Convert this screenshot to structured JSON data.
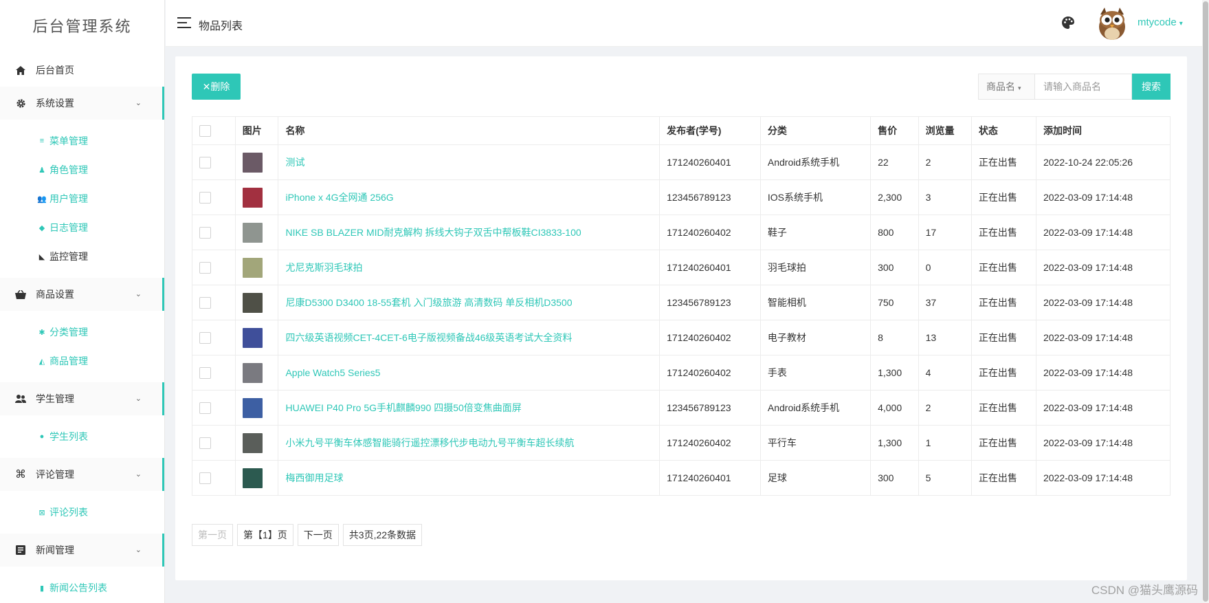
{
  "sidebar": {
    "brand": "后台管理系统",
    "home_label": "后台首页",
    "groups": [
      {
        "label": "系统设置",
        "icon": "gear-icon",
        "items": [
          {
            "label": "菜单管理",
            "icon": "list-icon"
          },
          {
            "label": "角色管理",
            "icon": "user-gear-icon"
          },
          {
            "label": "用户管理",
            "icon": "users-icon"
          },
          {
            "label": "日志管理",
            "icon": "tag-icon"
          },
          {
            "label": "监控管理",
            "icon": "cctv-icon"
          }
        ]
      },
      {
        "label": "商品设置",
        "icon": "basket-icon",
        "items": [
          {
            "label": "分类管理",
            "icon": "asterisk-icon"
          },
          {
            "label": "商品管理",
            "icon": "shirt-icon"
          }
        ]
      },
      {
        "label": "学生管理",
        "icon": "users-icon",
        "items": [
          {
            "label": "学生列表",
            "icon": "user-icon"
          }
        ]
      },
      {
        "label": "评论管理",
        "icon": "command-icon",
        "items": [
          {
            "label": "评论列表",
            "icon": "grid-icon"
          }
        ]
      },
      {
        "label": "新闻管理",
        "icon": "newspaper-icon",
        "items": [
          {
            "label": "新闻公告列表",
            "icon": "book-icon"
          }
        ]
      }
    ]
  },
  "header": {
    "title": "物品列表",
    "username": "mtycode",
    "caret": "▾"
  },
  "toolbar": {
    "delete_label": "✕删除",
    "search_field_label": "商品名",
    "search_field_caret": "▾",
    "search_placeholder": "请输入商品名",
    "search_button": "搜索"
  },
  "table": {
    "columns": [
      "图片",
      "名称",
      "发布者(学号)",
      "分类",
      "售价",
      "浏览量",
      "状态",
      "添加时间"
    ],
    "rows": [
      {
        "thumb_color": "#6b5a66",
        "name": "测试",
        "publisher": "171240260401",
        "category": "Android系统手机",
        "price": "22",
        "views": "2",
        "status": "正在出售",
        "time": "2022-10-24 22:05:26"
      },
      {
        "thumb_color": "#a23040",
        "name": "iPhone x 4G全网通 256G",
        "publisher": "123456789123",
        "category": "IOS系统手机",
        "price": "2,300",
        "views": "3",
        "status": "正在出售",
        "time": "2022-03-09 17:14:48"
      },
      {
        "thumb_color": "#8f9590",
        "name": "NIKE SB BLAZER MID耐克解构 拆线大钩子双舌中帮板鞋CI3833-100",
        "publisher": "171240260402",
        "category": "鞋子",
        "price": "800",
        "views": "17",
        "status": "正在出售",
        "time": "2022-03-09 17:14:48"
      },
      {
        "thumb_color": "#a2a67a",
        "name": "尤尼克斯羽毛球拍",
        "publisher": "171240260401",
        "category": "羽毛球拍",
        "price": "300",
        "views": "0",
        "status": "正在出售",
        "time": "2022-03-09 17:14:48"
      },
      {
        "thumb_color": "#4f5047",
        "name": "尼康D5300 D3400 18-55套机 入门级旅游 高清数码 单反相机D3500",
        "publisher": "123456789123",
        "category": "智能相机",
        "price": "750",
        "views": "37",
        "status": "正在出售",
        "time": "2022-03-09 17:14:48"
      },
      {
        "thumb_color": "#3f4f9a",
        "name": "四六级英语视频CET-4CET-6电子版视频备战46级英语考试大全资料",
        "publisher": "171240260402",
        "category": "电子教材",
        "price": "8",
        "views": "13",
        "status": "正在出售",
        "time": "2022-03-09 17:14:48"
      },
      {
        "thumb_color": "#7a7a80",
        "name": "Apple Watch5 Series5",
        "publisher": "171240260402",
        "category": "手表",
        "price": "1,300",
        "views": "4",
        "status": "正在出售",
        "time": "2022-03-09 17:14:48"
      },
      {
        "thumb_color": "#3d5fa3",
        "name": "HUAWEI P40 Pro 5G手机麒麟990 四摄50倍变焦曲面屏",
        "publisher": "123456789123",
        "category": "Android系统手机",
        "price": "4,000",
        "views": "2",
        "status": "正在出售",
        "time": "2022-03-09 17:14:48"
      },
      {
        "thumb_color": "#5a5e5a",
        "name": "小米九号平衡车体感智能骑行遥控漂移代步电动九号平衡车超长续航",
        "publisher": "171240260402",
        "category": "平行车",
        "price": "1,300",
        "views": "1",
        "status": "正在出售",
        "time": "2022-03-09 17:14:48"
      },
      {
        "thumb_color": "#2c5a50",
        "name": "梅西御用足球",
        "publisher": "171240260401",
        "category": "足球",
        "price": "300",
        "views": "5",
        "status": "正在出售",
        "time": "2022-03-09 17:14:48"
      }
    ]
  },
  "pager": {
    "first": "第一页",
    "current": "第【1】页",
    "next": "下一页",
    "summary": "共3页,22条数据"
  },
  "watermark": "CSDN @猫头鹰源码",
  "colors": {
    "accent": "#2ec7b7"
  }
}
